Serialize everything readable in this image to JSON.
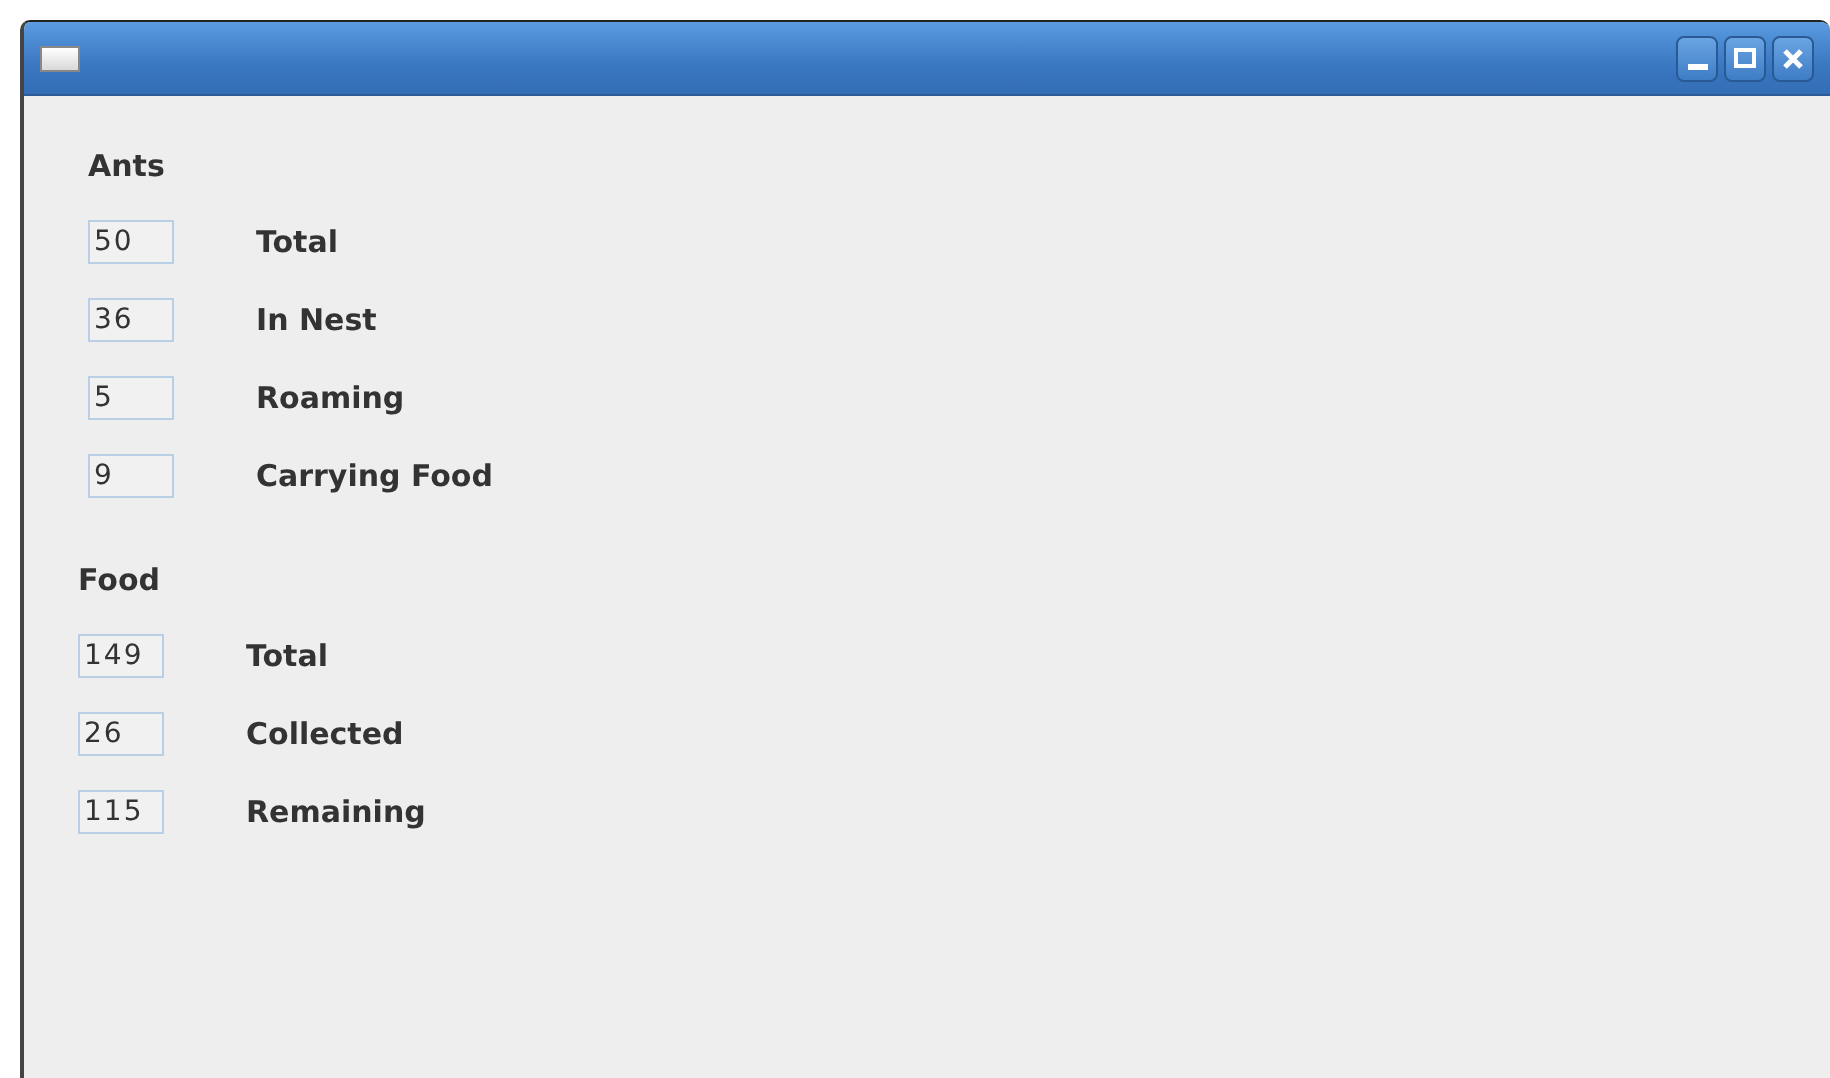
{
  "window": {
    "title_buttons": [
      {
        "kind": "minimize"
      },
      {
        "kind": "maximize"
      },
      {
        "kind": "close"
      }
    ]
  },
  "sections": [
    {
      "heading": "Ants",
      "stats": [
        {
          "value": "50",
          "label": "Total"
        },
        {
          "value": "36",
          "label": "In Nest"
        },
        {
          "value": "5",
          "label": "Roaming"
        },
        {
          "value": "9",
          "label": "Carrying Food"
        }
      ]
    },
    {
      "heading": "Food",
      "stats": [
        {
          "value": "149",
          "label": "Total"
        },
        {
          "value": "26",
          "label": "Collected"
        },
        {
          "value": "115",
          "label": "Remaining"
        }
      ]
    }
  ]
}
